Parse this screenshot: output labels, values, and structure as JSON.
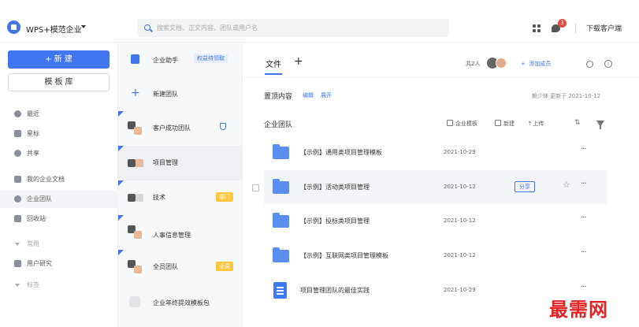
{
  "header": {
    "org_name": "WPS+模范企业",
    "search_placeholder": "搜索文档、正文内容、团队或用户名",
    "notification_count": "3",
    "download_client": "下载客户端"
  },
  "sidebar": {
    "new_button": "+ 新 建",
    "template_button": "模 板 库",
    "items": [
      {
        "label": "最近",
        "icon": "clock-icon"
      },
      {
        "label": "星标",
        "icon": "star-icon"
      },
      {
        "label": "共享",
        "icon": "share-icon"
      },
      {
        "label": "我的企业文档",
        "icon": "doc-icon"
      },
      {
        "label": "企业团队",
        "icon": "team-icon"
      },
      {
        "label": "回收站",
        "icon": "trash-icon"
      },
      {
        "label": "常用",
        "icon": "chevron-down-icon"
      },
      {
        "label": "用户研究",
        "icon": "folder-icon"
      },
      {
        "label": "标签",
        "icon": "chevron-down-icon"
      }
    ]
  },
  "teams": {
    "assistant": {
      "name": "企业助手",
      "tag": "权益待领取"
    },
    "new_team": {
      "name": "新建团队"
    },
    "list": [
      {
        "name": "客户成功团队"
      },
      {
        "name": "项目管理"
      },
      {
        "name": "技术",
        "tag": "部门"
      },
      {
        "name": "人事信息管理"
      },
      {
        "name": "全员团队",
        "tag": "全员"
      },
      {
        "name": "企业年终提效模板包"
      }
    ]
  },
  "main": {
    "tab_file": "文件",
    "member_count": "共2人",
    "add_member": "添加成员",
    "pinned_title": "置顶内容",
    "pinned_edit": "编辑",
    "pinned_expand": "展开",
    "pinned_update": "赖少烽 更新于 2021-10-12",
    "section_title": "企业团队",
    "actions": {
      "template": "企业模板",
      "new": "新建",
      "upload": "上传"
    },
    "rows": [
      {
        "name": "【示例】通用类项目管理模板",
        "date": "2021-10-29",
        "type": "folder"
      },
      {
        "name": "【示例】活动类项目管理",
        "date": "2021-10-12",
        "type": "folder",
        "share": "分享"
      },
      {
        "name": "【示例】投标类项目管理",
        "date": "2021-10-12",
        "type": "folder"
      },
      {
        "name": "【示例】互联网类项目管理模板",
        "date": "2021-10-12",
        "type": "folder"
      },
      {
        "name": "项目管理团队的最佳实践",
        "date": "2021-10-29",
        "type": "doc"
      }
    ],
    "more_label": "···",
    "star_label": "☆"
  },
  "watermark": "最需网",
  "colors": {
    "accent": "#4176ee",
    "folder": "#5b8def",
    "tag_yellow": "#ffc53d",
    "badge": "#e74a3b"
  }
}
